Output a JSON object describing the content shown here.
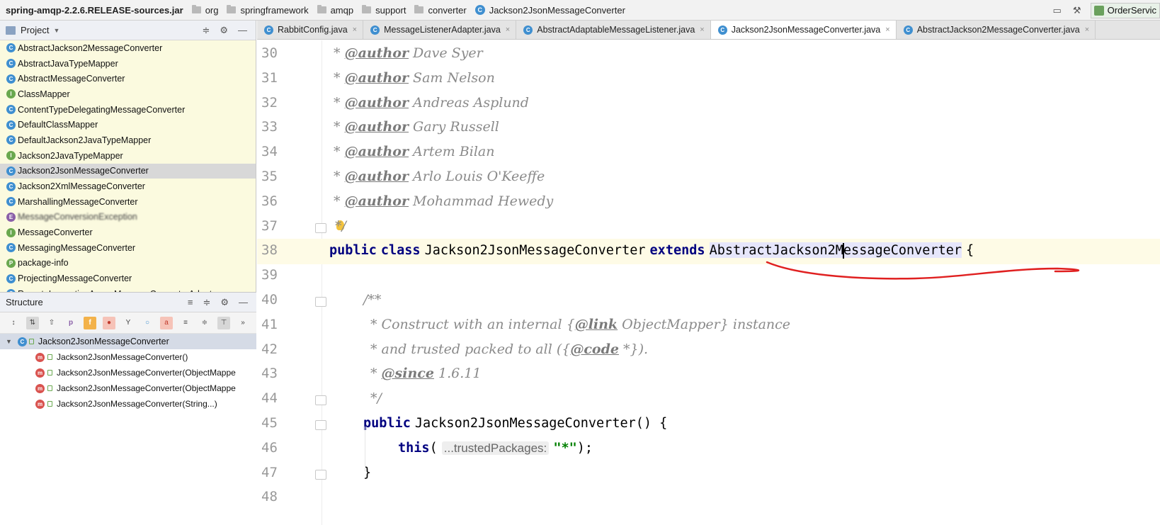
{
  "navbar": {
    "crumbs": [
      {
        "label": "spring-amqp-2.2.6.RELEASE-sources.jar",
        "type": "jar"
      },
      {
        "label": "org",
        "type": "folder"
      },
      {
        "label": "springframework",
        "type": "folder"
      },
      {
        "label": "amqp",
        "type": "folder"
      },
      {
        "label": "support",
        "type": "folder"
      },
      {
        "label": "converter",
        "type": "folder"
      },
      {
        "label": "Jackson2JsonMessageConverter",
        "type": "class"
      }
    ],
    "run_config": "OrderServic"
  },
  "project_panel": {
    "title": "Project",
    "items": [
      {
        "label": "AbstractJackson2MessageConverter",
        "kind": "c"
      },
      {
        "label": "AbstractJavaTypeMapper",
        "kind": "c"
      },
      {
        "label": "AbstractMessageConverter",
        "kind": "c"
      },
      {
        "label": "ClassMapper",
        "kind": "i"
      },
      {
        "label": "ContentTypeDelegatingMessageConverter",
        "kind": "c"
      },
      {
        "label": "DefaultClassMapper",
        "kind": "c"
      },
      {
        "label": "DefaultJackson2JavaTypeMapper",
        "kind": "c"
      },
      {
        "label": "Jackson2JavaTypeMapper",
        "kind": "i"
      },
      {
        "label": "Jackson2JsonMessageConverter",
        "kind": "c",
        "selected": true
      },
      {
        "label": "Jackson2XmlMessageConverter",
        "kind": "c"
      },
      {
        "label": "MarshallingMessageConverter",
        "kind": "c"
      },
      {
        "label": "MessageConversionException",
        "kind": "e",
        "blurred": true
      },
      {
        "label": "MessageConverter",
        "kind": "i"
      },
      {
        "label": "MessagingMessageConverter",
        "kind": "c"
      },
      {
        "label": "package-info",
        "kind": "p"
      },
      {
        "label": "ProjectingMessageConverter",
        "kind": "c"
      },
      {
        "label": "RemoteInvocationAwareMessageConverterAdapter",
        "kind": "c"
      }
    ]
  },
  "structure_panel": {
    "title": "Structure",
    "root": "Jackson2JsonMessageConverter",
    "members": [
      "Jackson2JsonMessageConverter()",
      "Jackson2JsonMessageConverter(ObjectMappe",
      "Jackson2JsonMessageConverter(ObjectMappe",
      "Jackson2JsonMessageConverter(String...)"
    ]
  },
  "tabs": [
    {
      "label": "RabbitConfig.java",
      "active": false
    },
    {
      "label": "MessageListenerAdapter.java",
      "active": false
    },
    {
      "label": "AbstractAdaptableMessageListener.java",
      "active": false
    },
    {
      "label": "Jackson2JsonMessageConverter.java",
      "active": true
    },
    {
      "label": "AbstractJackson2MessageConverter.java",
      "active": false
    }
  ],
  "editor": {
    "line_numbers": [
      "30",
      "31",
      "32",
      "33",
      "34",
      "35",
      "36",
      "37",
      "38",
      "39",
      "40",
      "41",
      "42",
      "43",
      "44",
      "45",
      "46",
      "47",
      "48"
    ],
    "authors": [
      "Dave Syer",
      "Sam Nelson",
      "Andreas Asplund",
      "Gary Russell",
      "Artem Bilan",
      "Arlo Louis O'Keeffe",
      "Mohammad Hewedy"
    ],
    "author_tag": "@author",
    "class_decl": {
      "kw_public": "public",
      "kw_class": "class",
      "name": "Jackson2JsonMessageConverter",
      "kw_extends": "extends",
      "super_a": "AbstractJackson2M",
      "super_b": "essageConverter",
      "brace": "{"
    },
    "javadoc": {
      "open": "/**",
      "line1_a": "* Construct with an internal ",
      "link_tag": "@link",
      "link_target": "ObjectMapper",
      "line1_b": " instance",
      "line2_a": "* and trusted packed to all (",
      "code_tag": "@code",
      "code_val": " *",
      "line2_b": ").",
      "since_tag": "@since",
      "since_val": " 1.6.11",
      "close": "*/",
      "star": "*"
    },
    "ctor": {
      "kw_public": "public",
      "name": "Jackson2JsonMessageConverter() {",
      "this_kw": "this",
      "param_hint": "...trustedPackages:",
      "arg": "\"*\"",
      "tail": ");",
      "close": "}"
    },
    "doc_end": "*/",
    "annotation_color": "#e02020"
  }
}
